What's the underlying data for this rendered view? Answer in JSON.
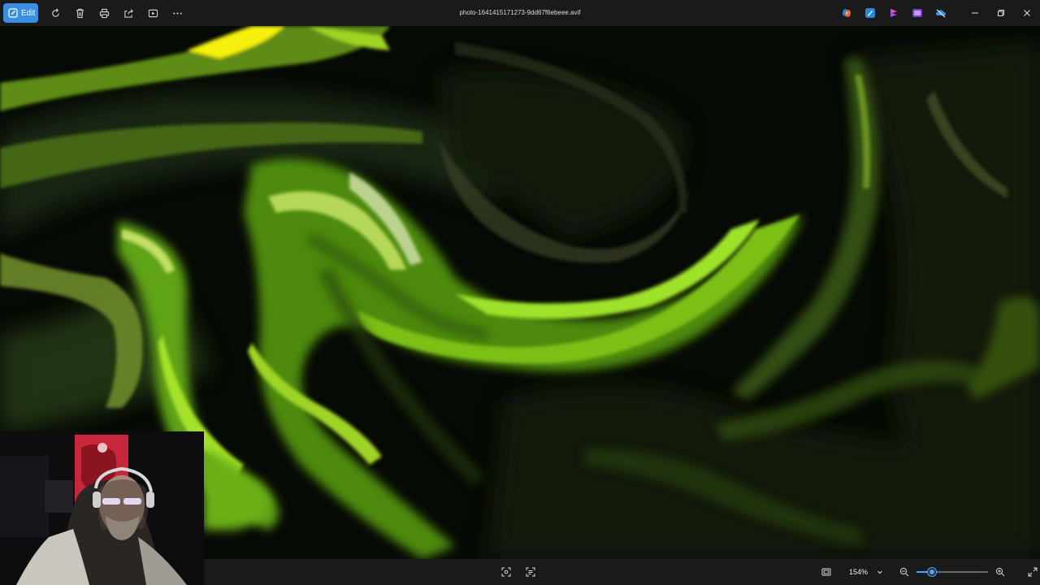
{
  "toolbar": {
    "edit_label": "Edit",
    "tools": [
      "rotate-icon",
      "delete-icon",
      "print-icon",
      "share-icon",
      "slideshow-icon",
      "more-icon"
    ]
  },
  "window": {
    "title": "photo-1641415171273-9dd67f6ebeee.avif"
  },
  "taskbar_apps": [
    "copilot-icon",
    "designer-icon",
    "clipchamp-icon",
    "photos-app-icon",
    "onedrive-icon"
  ],
  "bottombar": {
    "zoom_value": "154%",
    "zoom_fraction": 0.22
  },
  "colors": {
    "accent": "#3b8ee0",
    "slider": "#4fa8ff",
    "image_green": "#7bc018",
    "image_yellow": "#f5f010"
  }
}
